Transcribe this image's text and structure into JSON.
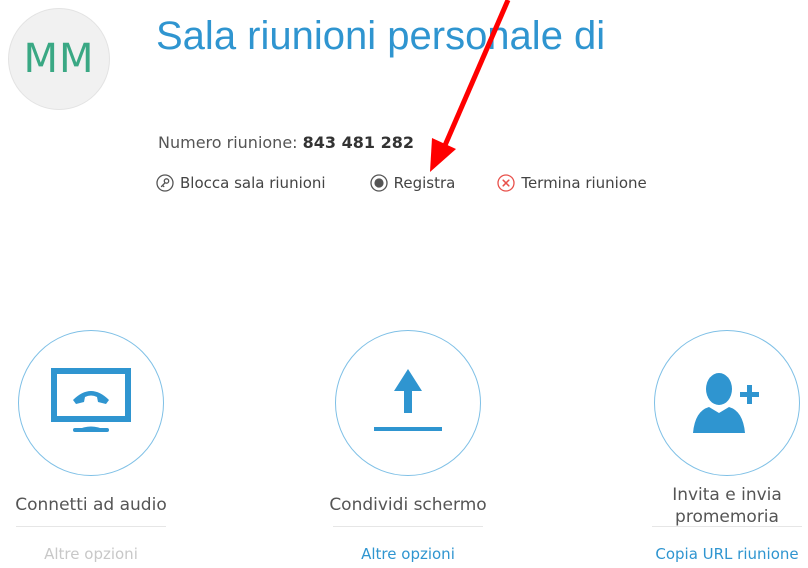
{
  "avatar": {
    "initials": "MM"
  },
  "header": {
    "title": "Sala riunioni personale di",
    "meeting_number_label": "Numero riunione:",
    "meeting_number_value": "843 481 282"
  },
  "actions": {
    "lock_label": "Blocca sala riunioni",
    "record_label": "Registra",
    "end_label": "Termina riunione"
  },
  "tiles": {
    "audio": {
      "label": "Connetti ad audio",
      "sub": "Altre opzioni"
    },
    "share": {
      "label": "Condividi schermo",
      "sub": "Altre opzioni"
    },
    "invite": {
      "label_line1": "Invita e invia",
      "label_line2": "promemoria",
      "sub": "Copia URL riunione"
    }
  },
  "colors": {
    "accent": "#2f95d0",
    "avatar_text": "#3aa884",
    "end_icon": "#e8504a",
    "annotation_arrow": "#ff0000"
  }
}
